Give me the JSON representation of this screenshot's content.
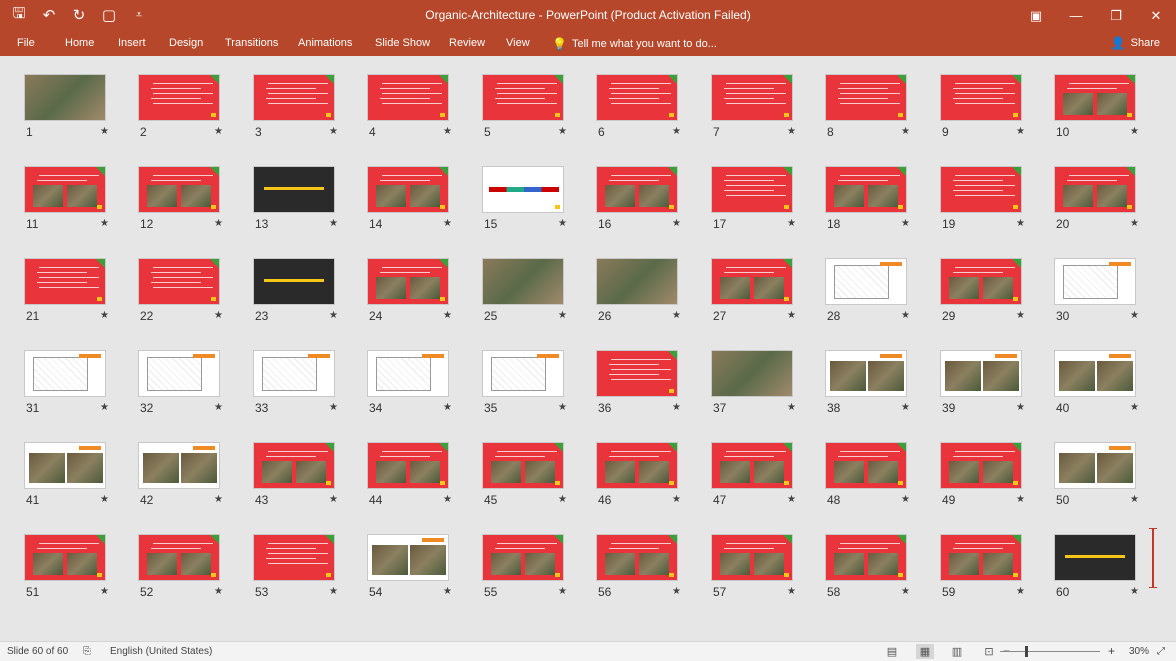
{
  "titlebar": {
    "title": "Organic-Architecture - PowerPoint (Product Activation Failed)",
    "qat_icons": [
      "save-icon",
      "undo-icon",
      "redo-icon",
      "present-icon",
      "customize-icon"
    ],
    "qat_glyphs": [
      "🖫",
      "↶",
      "↻",
      "▢",
      "⩡"
    ],
    "win_glyphs": [
      "▣",
      "—",
      "❐",
      "✕"
    ]
  },
  "ribbon": {
    "tabs": [
      "File",
      "Home",
      "Insert",
      "Design",
      "Transitions",
      "Animations",
      "Slide Show",
      "Review",
      "View"
    ],
    "tell_me": "Tell me what you want to do...",
    "share": "Share"
  },
  "slides": [
    {
      "n": "1",
      "t": "photo"
    },
    {
      "n": "2",
      "t": "red"
    },
    {
      "n": "3",
      "t": "red"
    },
    {
      "n": "4",
      "t": "red"
    },
    {
      "n": "5",
      "t": "red"
    },
    {
      "n": "6",
      "t": "red"
    },
    {
      "n": "7",
      "t": "red"
    },
    {
      "n": "8",
      "t": "red"
    },
    {
      "n": "9",
      "t": "red"
    },
    {
      "n": "10",
      "t": "redpic"
    },
    {
      "n": "11",
      "t": "redpic"
    },
    {
      "n": "12",
      "t": "redpic"
    },
    {
      "n": "13",
      "t": "dark"
    },
    {
      "n": "14",
      "t": "redpic"
    },
    {
      "n": "15",
      "t": "white"
    },
    {
      "n": "16",
      "t": "redpic"
    },
    {
      "n": "17",
      "t": "red"
    },
    {
      "n": "18",
      "t": "redpic"
    },
    {
      "n": "19",
      "t": "red"
    },
    {
      "n": "20",
      "t": "redpic"
    },
    {
      "n": "21",
      "t": "red"
    },
    {
      "n": "22",
      "t": "red"
    },
    {
      "n": "23",
      "t": "dark"
    },
    {
      "n": "24",
      "t": "redpic"
    },
    {
      "n": "25",
      "t": "photo"
    },
    {
      "n": "26",
      "t": "photo"
    },
    {
      "n": "27",
      "t": "redpic"
    },
    {
      "n": "28",
      "t": "plan"
    },
    {
      "n": "29",
      "t": "redpic"
    },
    {
      "n": "30",
      "t": "plan"
    },
    {
      "n": "31",
      "t": "plan"
    },
    {
      "n": "32",
      "t": "plan"
    },
    {
      "n": "33",
      "t": "plan"
    },
    {
      "n": "34",
      "t": "plan"
    },
    {
      "n": "35",
      "t": "plan"
    },
    {
      "n": "36",
      "t": "red"
    },
    {
      "n": "37",
      "t": "photo"
    },
    {
      "n": "38",
      "t": "whitepic"
    },
    {
      "n": "39",
      "t": "whitepic"
    },
    {
      "n": "40",
      "t": "whitepic"
    },
    {
      "n": "41",
      "t": "whitepic"
    },
    {
      "n": "42",
      "t": "whitepic"
    },
    {
      "n": "43",
      "t": "redpic"
    },
    {
      "n": "44",
      "t": "redpic"
    },
    {
      "n": "45",
      "t": "redpic"
    },
    {
      "n": "46",
      "t": "redpic"
    },
    {
      "n": "47",
      "t": "redpic"
    },
    {
      "n": "48",
      "t": "redpic"
    },
    {
      "n": "49",
      "t": "redpic"
    },
    {
      "n": "50",
      "t": "whitepic"
    },
    {
      "n": "51",
      "t": "redpic"
    },
    {
      "n": "52",
      "t": "redpic"
    },
    {
      "n": "53",
      "t": "red"
    },
    {
      "n": "54",
      "t": "whitepic"
    },
    {
      "n": "55",
      "t": "redpic"
    },
    {
      "n": "56",
      "t": "redpic"
    },
    {
      "n": "57",
      "t": "redpic"
    },
    {
      "n": "58",
      "t": "redpic"
    },
    {
      "n": "59",
      "t": "redpic"
    },
    {
      "n": "60",
      "t": "dark"
    }
  ],
  "status": {
    "slide_info": "Slide 60 of 60",
    "language": "English (United States)",
    "zoom": "30%",
    "minus": "−",
    "plus": "+"
  },
  "colors": {
    "accent": "#b7472a",
    "slide_red": "#e8343a"
  }
}
